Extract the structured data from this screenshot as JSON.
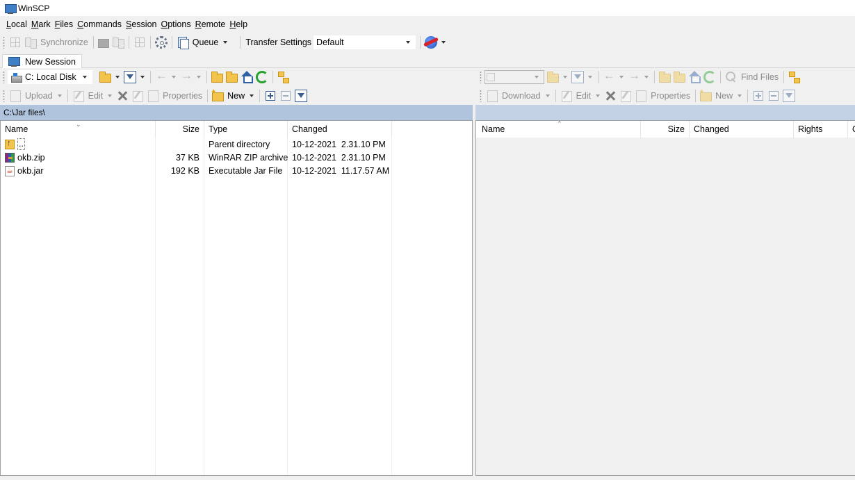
{
  "window": {
    "title": "WinSCP"
  },
  "menu": [
    {
      "label": "Local",
      "u": "L",
      "rest": "ocal"
    },
    {
      "label": "Mark",
      "u": "M",
      "rest": "ark"
    },
    {
      "label": "Files",
      "u": "F",
      "rest": "iles"
    },
    {
      "label": "Commands",
      "u": "C",
      "rest": "ommands"
    },
    {
      "label": "Session",
      "u": "S",
      "rest": "ession"
    },
    {
      "label": "Options",
      "u": "O",
      "rest": "ptions"
    },
    {
      "label": "Remote",
      "u": "R",
      "rest": "emote"
    },
    {
      "label": "Help",
      "u": "H",
      "rest": "elp"
    }
  ],
  "toolbar": {
    "synchronize_label": "Synchronize",
    "queue_label": "Queue",
    "transfer_settings_label": "Transfer Settings",
    "transfer_settings_value": "Default"
  },
  "tabs": {
    "new_session_label": "New Session"
  },
  "local": {
    "drive_label": "C: Local Disk",
    "toolbar": {
      "upload_label": "Upload",
      "edit_label": "Edit",
      "properties_label": "Properties",
      "new_label": "New"
    },
    "path": "C:\\Jar files\\",
    "columns": {
      "name": "Name",
      "size": "Size",
      "type": "Type",
      "changed": "Changed"
    },
    "files": [
      {
        "name": "..",
        "size": "",
        "type": "Parent directory",
        "changed": "10-12-2021  2.31.10 PM",
        "icon": "parent-folder-icon"
      },
      {
        "name": "okb.zip",
        "size": "37 KB",
        "type": "WinRAR ZIP archive",
        "changed": "10-12-2021  2.31.10 PM",
        "icon": "winrar-archive-icon"
      },
      {
        "name": "okb.jar",
        "size": "192 KB",
        "type": "Executable Jar File",
        "changed": "10-12-2021  11.17.57 AM",
        "icon": "java-jar-icon"
      }
    ]
  },
  "remote": {
    "toolbar": {
      "find_files_label": "Find Files",
      "download_label": "Download",
      "edit_label": "Edit",
      "properties_label": "Properties",
      "new_label": "New"
    },
    "columns": {
      "name": "Name",
      "size": "Size",
      "changed": "Changed",
      "rights": "Rights",
      "owner_partial": "O"
    }
  },
  "colors": {
    "path_bar_active": "#b0c4de",
    "path_bar_inactive": "#c3d2e5",
    "panel_bg": "#ffffff",
    "window_bg": "#f0f0f0"
  }
}
